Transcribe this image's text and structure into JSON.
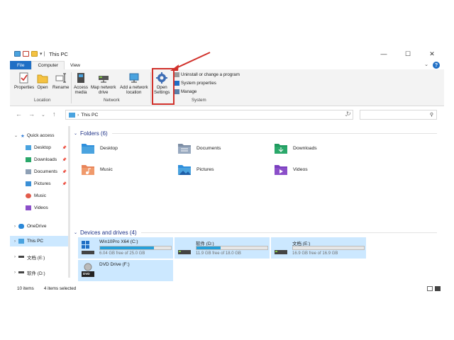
{
  "window": {
    "title": "This PC"
  },
  "tabs": [
    "File",
    "Computer",
    "View"
  ],
  "ribbon": {
    "location": {
      "label": "Location",
      "buttons": [
        "Properties",
        "Open",
        "Rename"
      ]
    },
    "network": {
      "label": "Network",
      "access_media": [
        "Access",
        "media"
      ],
      "map_drive": [
        "Map network",
        "drive"
      ],
      "add_location": [
        "Add a network",
        "location"
      ]
    },
    "system": {
      "label": "System",
      "open_settings": [
        "Open",
        "Settings"
      ],
      "small": [
        "Uninstall or change a program",
        "System properties",
        "Manage"
      ]
    }
  },
  "address": {
    "path": "This PC"
  },
  "sidebar": {
    "quick_access": "Quick access",
    "items": [
      "Desktop",
      "Downloads",
      "Documents",
      "Pictures",
      "Music",
      "Videos"
    ],
    "onedrive": "OneDrive",
    "thispc": "This PC",
    "drive_e": "文档 (E:)",
    "drive_d": "软件 (D:)"
  },
  "folders": {
    "header": "Folders (6)",
    "items": [
      "Desktop",
      "Documents",
      "Downloads",
      "Music",
      "Pictures",
      "Videos"
    ]
  },
  "drives": {
    "header": "Devices and drives (4)",
    "items": [
      {
        "name": "Win10Pro X64 (C:)",
        "free": "6.04 GB free of 25.0 GB",
        "used_fraction": 0.76
      },
      {
        "name": "软件 (D:)",
        "free": "11.9 GB free of 18.0 GB",
        "used_fraction": 0.34
      },
      {
        "name": "文档 (E:)",
        "free": "16.9 GB free of 16.9 GB",
        "used_fraction": 0.0
      },
      {
        "name": "DVD Drive (F:)",
        "free": "",
        "used_fraction": null
      },
      {
        "dvd_label": "DVD"
      }
    ]
  },
  "status": {
    "count": "10 items",
    "selected": "4 items selected"
  },
  "colors": {
    "accent": "#1f6fc5",
    "selection": "#cce8ff",
    "highlight": "#d1312b",
    "drivebar": "#26a0da"
  }
}
